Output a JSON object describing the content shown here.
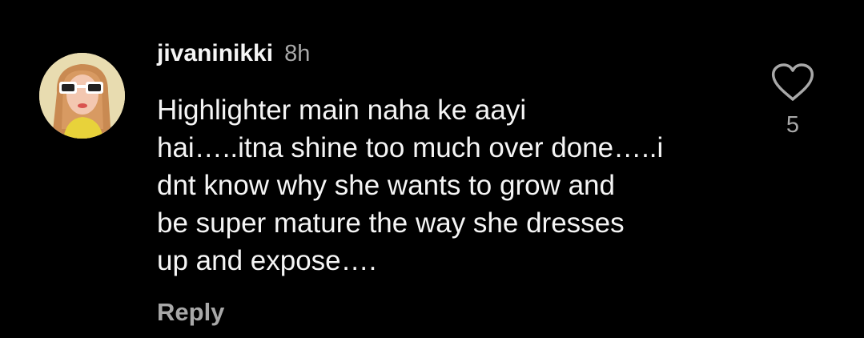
{
  "comment": {
    "username": "jivaninikki",
    "time": "8h",
    "text_lines": [
      "Highlighter main naha ke aayi",
      "hai…..itna shine too much over done…..i",
      "dnt know why she wants to grow and",
      "be super mature the way she dresses",
      "up and expose…."
    ],
    "reply_label": "Reply",
    "like_count": "5",
    "avatar_icon": "profile-photo",
    "like_icon": "heart-outline-icon"
  },
  "colors": {
    "background": "#000000",
    "primary_text": "#f5f5f5",
    "secondary_text": "#a8a8a8"
  }
}
